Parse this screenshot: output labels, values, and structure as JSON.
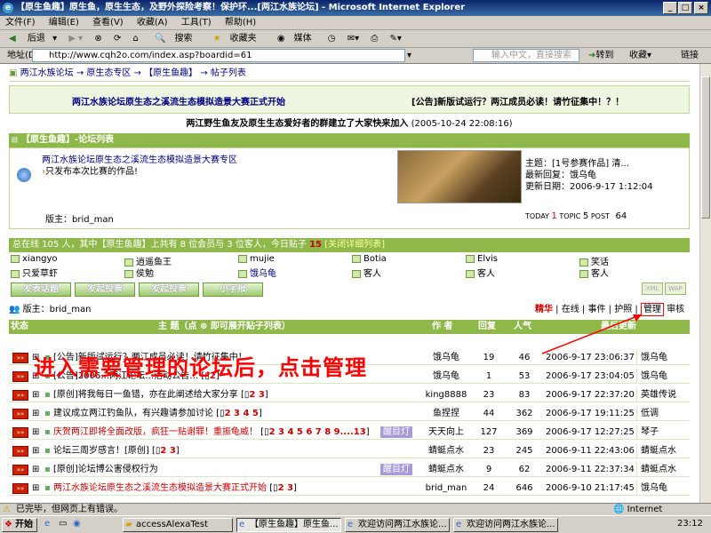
{
  "window": {
    "title": "【原生鱼趣】原生鱼，原生生态，及野外探险考察！保护环...[两江水族论坛] - Microsoft Internet Explorer",
    "minimize": "_",
    "maximize": "□",
    "close": "×"
  },
  "menu": [
    "文件(F)",
    "编辑(E)",
    "查看(V)",
    "收藏(A)",
    "工具(T)",
    "帮助(H)"
  ],
  "toolbar": {
    "back": "后退",
    "search": "搜索",
    "favorites": "收藏夹",
    "media": "媒体"
  },
  "address": {
    "label": "地址(D)",
    "url": "http://www.cqh2o.com/index.asp?boardid=61",
    "search_placeholder": "输入中文，直接搜索",
    "go": "转到",
    "favorites": "收藏",
    "links": "链接"
  },
  "breadcrumb": "两江水族论坛 → 原生态专区 → 【原生鱼趣】 → 帖子列表",
  "notice": {
    "left": "两江水族论坛原生态之溪流生态模拟造景大赛正式开始",
    "right": "[公告]新版试运行？两江成员必读！请竹征集中！？！"
  },
  "announce_line": {
    "text": "两江野生鱼友及原生生态爱好者的群建立了大家快来加入",
    "date": "(2005-10-24 22:08:16)"
  },
  "forum": {
    "header": "【原生鱼趣】-论坛列表",
    "desc": "两江水族论坛原生态之溪流生态模拟造景大赛专区",
    "desc2": "只发布本次比赛的作品!",
    "topic": "主题：[1号参赛作品] 清...",
    "last_reply": "最新回复：饿乌龟",
    "updated": "更新日期：2006-9-17 1:12:04",
    "moderator": "版主：brid_man",
    "today_label": "TODAY",
    "today": "1",
    "topic_label": "TOPIC",
    "topic_count": "5",
    "post_label": "POST",
    "post_count": "64"
  },
  "online": {
    "summary": "总在线 105 人，其中【原生鱼趣】上共有 8 位会员与 3 位客人，今日贴子",
    "today_posts": "15",
    "detail": "[关闭详细列表]",
    "users": [
      [
        "xiangyo",
        "逍遥鱼王",
        "mujie",
        "Botia",
        "Elvis",
        "笑话"
      ],
      [
        "只爱草虾",
        "侯勉",
        "饿乌龟",
        "客人",
        "客人",
        "客人"
      ]
    ]
  },
  "actions": {
    "new_post": "发表话题",
    "new_vote": "发起投票",
    "new_poll": "发起投票",
    "small": "小字报",
    "xml": "XML",
    "wap": "WAP"
  },
  "board_bar": {
    "moderator": "版主：brid_man",
    "links": [
      "精华",
      "在线",
      "事件",
      "护照",
      "管理",
      "审核"
    ]
  },
  "table": {
    "headers": {
      "status": "状态",
      "topic": "主 题（点",
      "topic_hint": "即可展开贴子列表）",
      "author": "作 者",
      "replies": "回复",
      "views": "人气",
      "last": "最后更新"
    },
    "rows": [
      {
        "title": "[公告]新版试运行？两江成员必读！请竹征集中！",
        "pages": "",
        "badge": "",
        "author": "饿乌龟",
        "replies": "19",
        "views": "46",
        "date": "2006-9-17 23:06:37",
        "last_user": "饿乌龟"
      },
      {
        "title": "[公告]2006…两江论坛…活动公告…",
        "pages": "2",
        "badge": "",
        "author": "饿乌龟",
        "replies": "1",
        "views": "53",
        "date": "2006-9-17 23:04:05",
        "last_user": "饿乌龟"
      },
      {
        "title": "[原创]将我每日一鱼错，亦在此阐述给大家分享",
        "pages": "2 3",
        "badge": "",
        "author": "king8888",
        "replies": "23",
        "views": "83",
        "date": "2006-9-17 22:37:20",
        "last_user": "英雄传说"
      },
      {
        "title": "建议成立两江钓鱼队，有兴趣请参加讨论",
        "pages": "2 3 4 5",
        "badge": "",
        "author": "鱼捏捏",
        "replies": "44",
        "views": "362",
        "date": "2006-9-17 19:11:25",
        "last_user": "低调"
      },
      {
        "title": "庆贺两江即将全面改版，疯狂一贴谢罪！重振龟威！",
        "pages": "2 3 4 5 6 7 8 9....13",
        "badge": "醒目灯",
        "author": "天天向上",
        "replies": "127",
        "views": "369",
        "date": "2006-9-17 12:27:25",
        "last_user": "琴子"
      },
      {
        "title": "论坛三周岁感言！[原创]",
        "pages": "2 3",
        "badge": "",
        "author": "蜻蜓点水",
        "replies": "23",
        "views": "245",
        "date": "2006-9-11 22:43:06",
        "last_user": "蜻蜓点水"
      },
      {
        "title": "[原创]论坛博公害侵权行为",
        "pages": "",
        "badge": "醒目灯",
        "author": "蜻蜓点水",
        "replies": "9",
        "views": "62",
        "date": "2006-9-11 22:37:34",
        "last_user": "蜻蜓点水"
      },
      {
        "title": "两江水族论坛原生态之溪流生态模拟造景大赛正式开始",
        "pages": "2 3",
        "badge": "",
        "author": "brid_man",
        "replies": "24",
        "views": "646",
        "date": "2006-9-10 21:17:45",
        "last_user": "饿乌龟"
      }
    ]
  },
  "annotation": "进入需要管理的论坛后，点击管理",
  "status": "已完毕，但网页上有错误。",
  "status_zone": "Internet",
  "taskbar": {
    "start": "开始",
    "tasks": [
      "accessAlexaTest",
      "【原生鱼趣】原生鱼...",
      "欢迎访问两江水族论...",
      "欢迎访问两江水族论..."
    ],
    "clock": "23:12"
  },
  "colors": {
    "accent_green": "#8fb84a",
    "annotation_red": "#ff0000",
    "link_blue": "#000080"
  }
}
